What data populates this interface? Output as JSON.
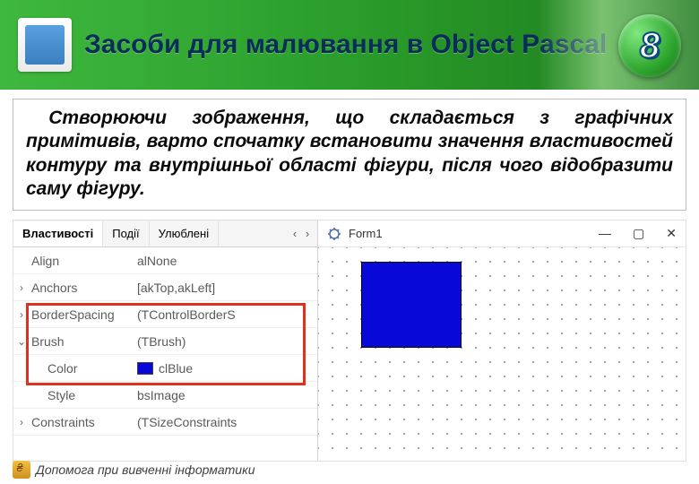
{
  "header": {
    "title": "Засоби для малювання в Object Pascal",
    "badge": "8"
  },
  "description": "Створюючи зображення, що складається з графічних примітивів, варто спочатку встановити значення властивостей контуру та внутрішньої області фігури, після чого відобразити саму фігуру.",
  "inspector": {
    "tabs": [
      {
        "label": "Властивості",
        "active": true
      },
      {
        "label": "Події",
        "active": false
      },
      {
        "label": "Улюблені",
        "active": false
      }
    ],
    "scroll_left": "‹",
    "scroll_right": "›",
    "rows": [
      {
        "expand": "",
        "name": "Align",
        "value": "alNone",
        "indent": false
      },
      {
        "expand": "›",
        "name": "Anchors",
        "value": "[akTop,akLeft]",
        "indent": false
      },
      {
        "expand": "›",
        "name": "BorderSpacing",
        "value": "(TControlBorderS",
        "indent": false
      },
      {
        "expand": "⌄",
        "name": "Brush",
        "value": "(TBrush)",
        "indent": false
      },
      {
        "expand": "",
        "name": "Color",
        "value": "clBlue",
        "indent": true,
        "swatch": true
      },
      {
        "expand": "",
        "name": "Style",
        "value": "bsImage",
        "indent": true
      },
      {
        "expand": "›",
        "name": "Constraints",
        "value": "(TSizeConstraints",
        "indent": false
      }
    ]
  },
  "designer": {
    "title": "Form1",
    "win": {
      "min": "—",
      "max": "▢",
      "close": "✕"
    }
  },
  "footer": "Допомога при вивченні інформатики"
}
